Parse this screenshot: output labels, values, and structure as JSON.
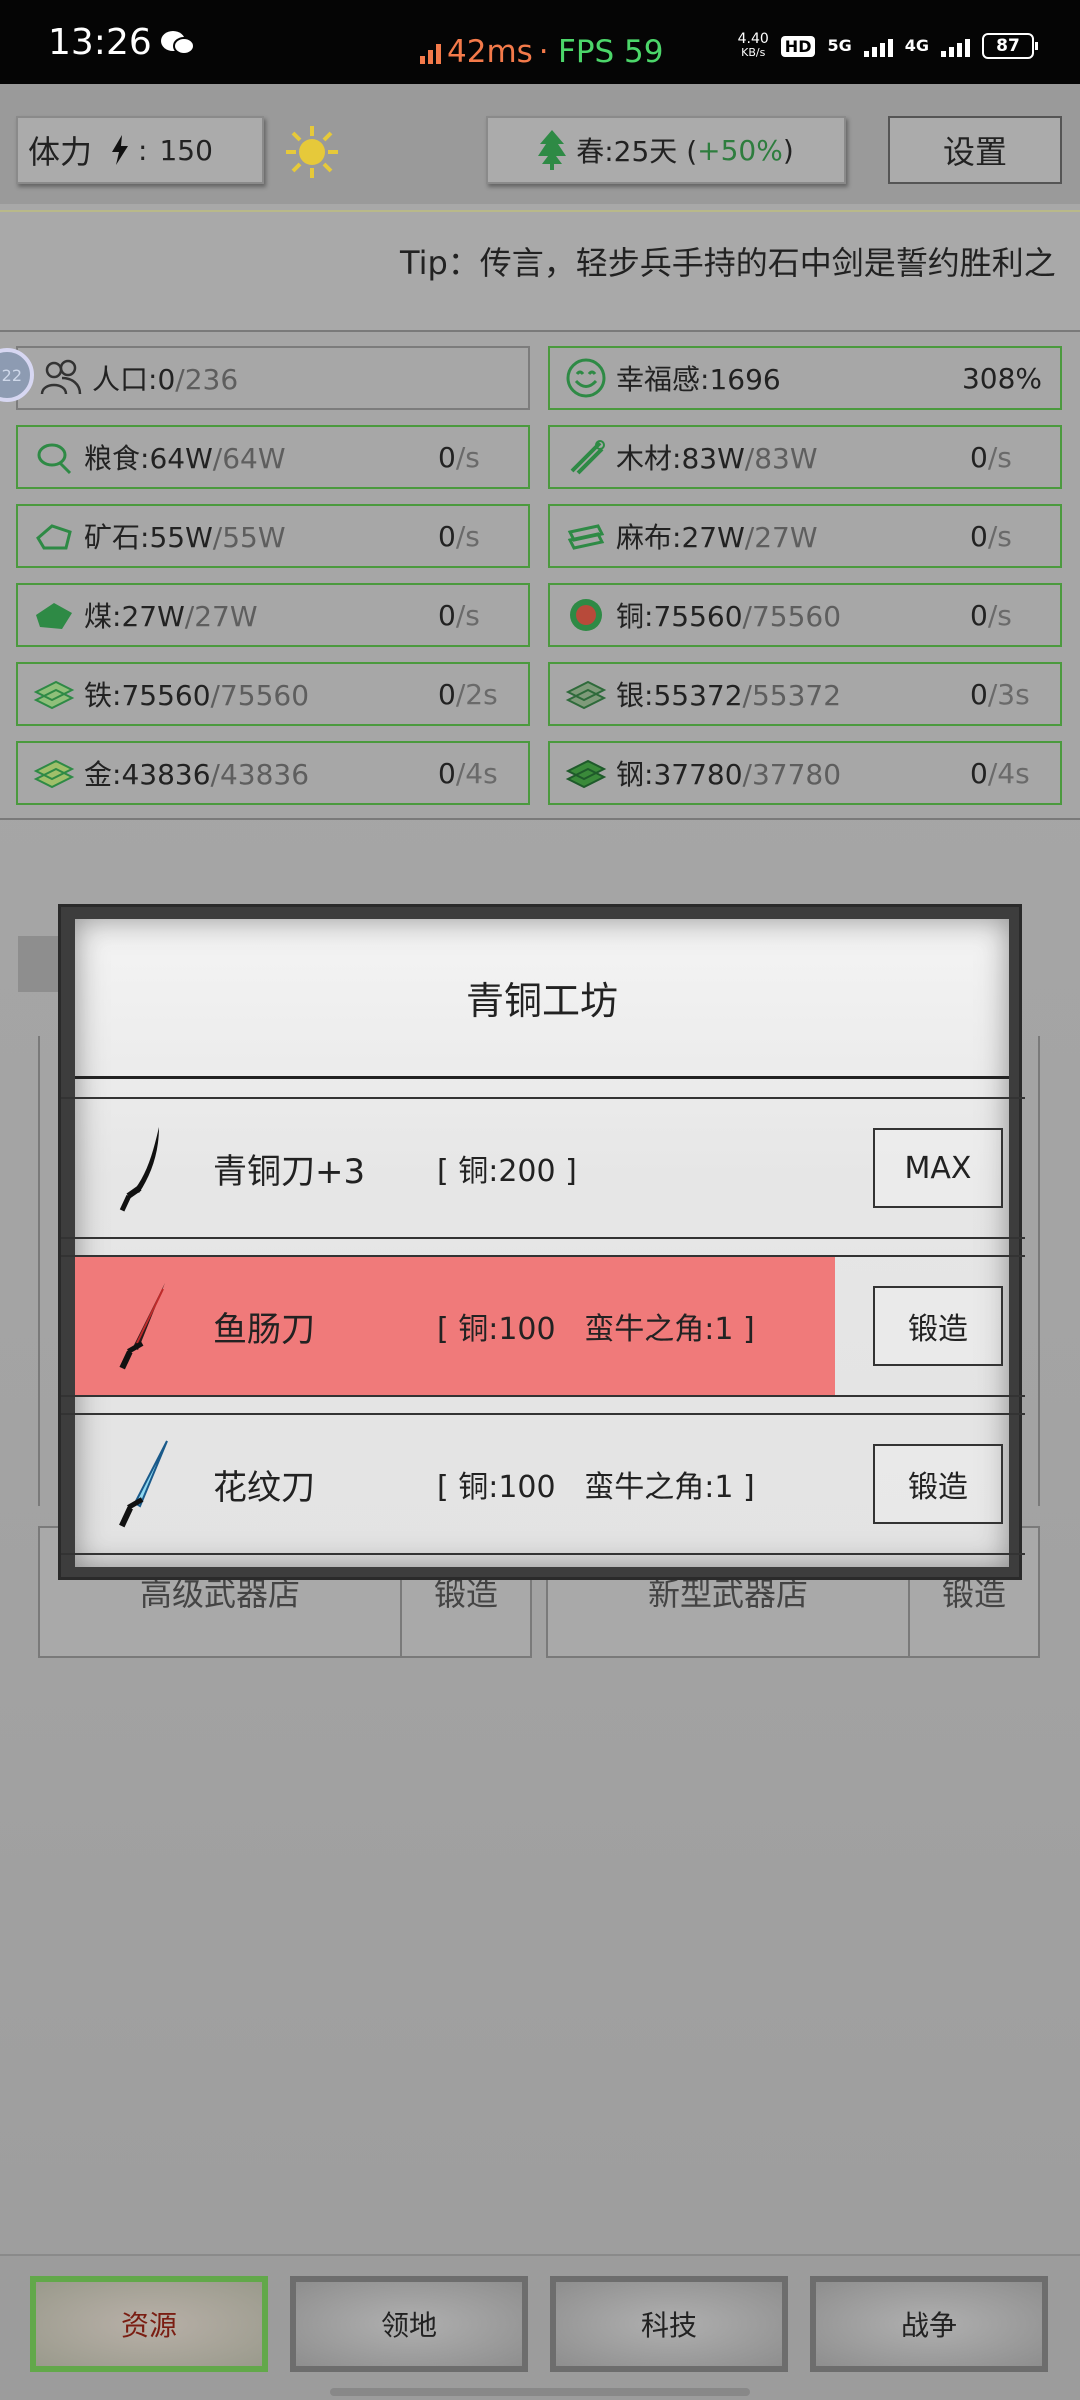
{
  "status_bar": {
    "time": "13:26",
    "ping": "42ms",
    "separator": "·",
    "fps": "FPS 59",
    "net_speed_value": "4.40",
    "net_speed_unit": "KB/s",
    "hd_label": "HD",
    "network_type_1": "5G",
    "network_type_2": "4G",
    "battery": "87",
    "colors": {
      "ping": "#f47a4a",
      "fps": "#4cd66a"
    }
  },
  "header": {
    "stamina_label": "体力",
    "stamina_sep": ":",
    "stamina_value": "150",
    "season_text": "春:25天 (",
    "season_bonus": "+50%",
    "season_close": ")",
    "settings_label": "设置",
    "tip_text": "Tip：传言，轻步兵手持的石中剑是誓约胜利之"
  },
  "level_badge": "22",
  "resources": {
    "population": {
      "label": "人口:",
      "value": "0",
      "max": "/236"
    },
    "happiness": {
      "label": "幸福感:",
      "value": "1696",
      "percent": "308%"
    },
    "items": [
      {
        "icon": "grain-icon",
        "label": "粮食:",
        "value": "64W",
        "max": "/64W",
        "rate": "0",
        "unit": "/s"
      },
      {
        "icon": "wood-icon",
        "label": "木材:",
        "value": "83W",
        "max": "/83W",
        "rate": "0",
        "unit": "/s"
      },
      {
        "icon": "ore-icon",
        "label": "矿石:",
        "value": "55W",
        "max": "/55W",
        "rate": "0",
        "unit": "/s"
      },
      {
        "icon": "linen-icon",
        "label": "麻布:",
        "value": "27W",
        "max": "/27W",
        "rate": "0",
        "unit": "/s"
      },
      {
        "icon": "coal-icon",
        "label": "煤:",
        "value": "27W",
        "max": "/27W",
        "rate": "0",
        "unit": "/s"
      },
      {
        "icon": "copper-icon",
        "label": "铜:",
        "value": "75560",
        "max": "/75560",
        "rate": "0",
        "unit": "/s"
      },
      {
        "icon": "iron-icon",
        "label": "铁:",
        "value": "75560",
        "max": "/75560",
        "rate": "0",
        "unit": "/2s"
      },
      {
        "icon": "silver-icon",
        "label": "银:",
        "value": "55372",
        "max": "/55372",
        "rate": "0",
        "unit": "/3s"
      },
      {
        "icon": "gold-icon",
        "label": "金:",
        "value": "43836",
        "max": "/43836",
        "rate": "0",
        "unit": "/4s"
      },
      {
        "icon": "steel-icon",
        "label": "钢:",
        "value": "37780",
        "max": "/37780",
        "rate": "0",
        "unit": "/4s"
      }
    ]
  },
  "background_buildings": [
    {
      "name": "高级武器店",
      "action": "锻造"
    },
    {
      "name": "新型武器店",
      "action": "锻造"
    }
  ],
  "modal": {
    "title": "青铜工坊",
    "items": [
      {
        "name": "青铜刀+3",
        "cost": "[ 铜:200 ]",
        "button": "MAX",
        "highlighted": false
      },
      {
        "name": "鱼肠刀",
        "cost": "[ 铜:100   蛮牛之角:1 ]",
        "button": "锻造",
        "highlighted": true
      },
      {
        "name": "花纹刀",
        "cost": "[ 铜:100   蛮牛之角:1 ]",
        "button": "锻造",
        "highlighted": false
      }
    ],
    "highlight_color": "#f07a7a"
  },
  "bottom_nav": [
    {
      "label": "资源",
      "active": true
    },
    {
      "label": "领地",
      "active": false
    },
    {
      "label": "科技",
      "active": false
    },
    {
      "label": "战争",
      "active": false
    }
  ]
}
